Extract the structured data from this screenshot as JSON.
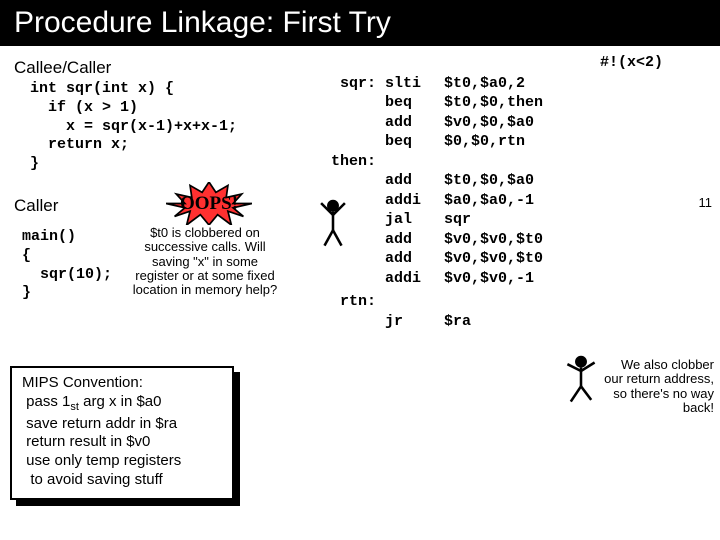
{
  "title": "Procedure Linkage: First Try",
  "callee_header": "Callee/Caller",
  "caller_header": "Caller",
  "c_sqr": "int sqr(int x) {\n  if (x > 1)\n    x = sqr(x-1)+x+x-1;\n  return x;\n}",
  "c_main": "main()\n{\n  sqr(10);\n}",
  "oops_text": "OOPS!",
  "note_text": "$t0 is clobbered on successive calls. Will saving \"x\" in some register or at some fixed location in memory help?",
  "asm": {
    "sqr_label": "sqr:",
    "then_label": "then:",
    "rtn_label": "rtn:",
    "l1": {
      "ins": "slti",
      "args": "$t0,$a0,2"
    },
    "l2": {
      "ins": "beq",
      "args": "$t0,$0,then"
    },
    "l3": {
      "ins": "add",
      "args": "$v0,$0,$a0"
    },
    "l4": {
      "ins": "beq",
      "args": "$0,$0,rtn"
    },
    "l5": {
      "ins": "add",
      "args": "$t0,$0,$a0"
    },
    "l6": {
      "ins": "addi",
      "args": "$a0,$a0,-1"
    },
    "l7": {
      "ins": "jal",
      "args": "sqr"
    },
    "l8": {
      "ins": "add",
      "args": "$v0,$v0,$t0"
    },
    "l9": {
      "ins": "add",
      "args": "$v0,$v0,$t0"
    },
    "l10": {
      "ins": "addi",
      "args": "$v0,$v0,-1"
    },
    "l11": {
      "ins": "jr",
      "args": "$ra"
    }
  },
  "comment1": "#!(x<2)",
  "comment2": "We also clobber our return address, so there's no way back!",
  "mips_title": "MIPS Convention:",
  "mips_l1a": "pass 1",
  "mips_l1b": "st",
  "mips_l1c": " arg x in $a0",
  "mips_l2": "save return addr in $ra",
  "mips_l3": "return result in $v0",
  "mips_l4": "use only temp registers",
  "mips_l5": " to avoid saving stuff",
  "slidenum": "11"
}
